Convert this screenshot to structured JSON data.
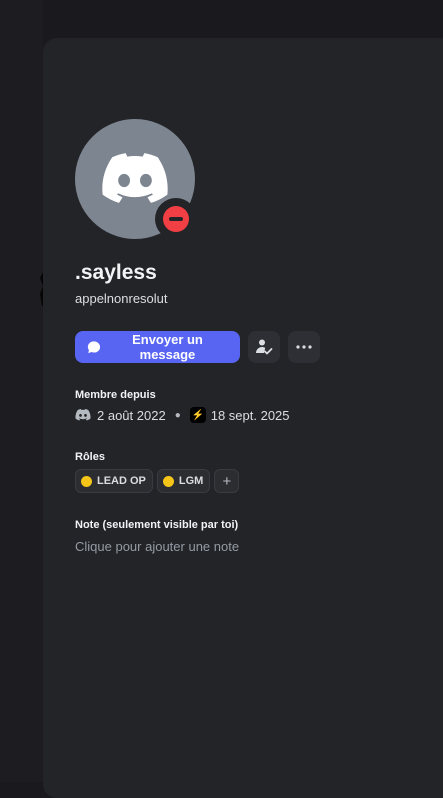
{
  "profile": {
    "display_name": ".sayless",
    "username": "appelnonresolut",
    "status": "dnd",
    "message_button_label": "Envoyer un message"
  },
  "member_since": {
    "title": "Membre depuis",
    "discord_date": "2 août 2022",
    "server_date": "18 sept. 2025"
  },
  "roles": {
    "title": "Rôles",
    "items": [
      {
        "label": "LEAD OP",
        "color": "#f5c518"
      },
      {
        "label": "LGM",
        "color": "#f5c518"
      }
    ],
    "add_symbol": "+"
  },
  "note": {
    "title": "Note (seulement visible par toi)",
    "placeholder": "Clique pour ajouter une note"
  },
  "colors": {
    "accent": "#5865f2",
    "dnd": "#f23f43",
    "panel": "#232428"
  }
}
